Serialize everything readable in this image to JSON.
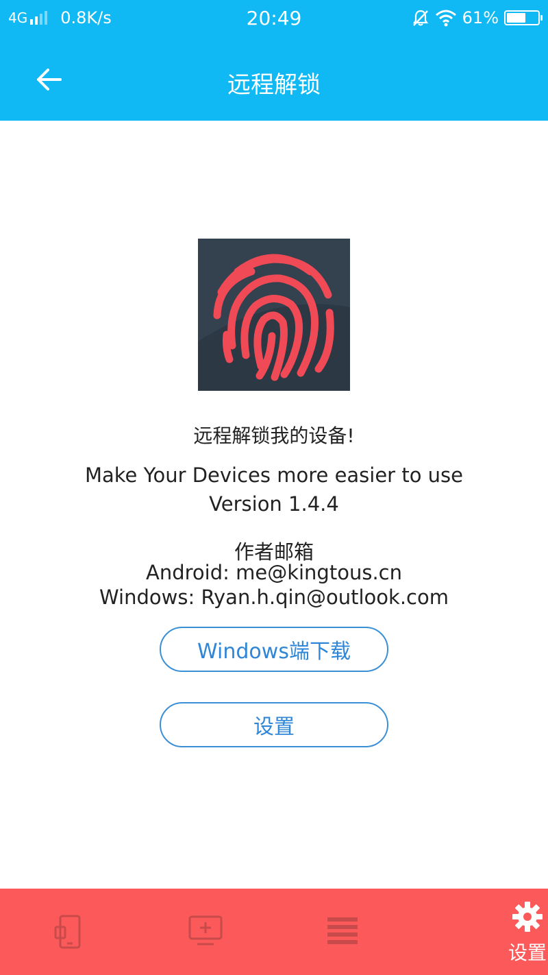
{
  "status_bar": {
    "network": "4G",
    "speed": "0.8K/s",
    "time": "20:49",
    "battery": "61%",
    "battery_level": 0.61
  },
  "app_bar": {
    "title": "远程解锁",
    "back_icon": "arrow-left-icon"
  },
  "about": {
    "logo_icon": "fingerprint-icon",
    "tagline": "远程解锁我的设备!",
    "slogan": "Make Your Devices more easier to use",
    "version": "Version 1.4.4",
    "email_heading": "作者邮箱",
    "email_android": "Android: me@kingtous.cn",
    "email_windows": "Windows: Ryan.h.qin@outlook.com"
  },
  "buttons": {
    "download": "Windows端下载",
    "settings": "设置"
  },
  "bottom_nav": {
    "items": [
      {
        "icon": "phone-icon",
        "label": ""
      },
      {
        "icon": "monitor-add-icon",
        "label": ""
      },
      {
        "icon": "list-icon",
        "label": ""
      },
      {
        "icon": "gear-icon",
        "label": "设置"
      }
    ]
  },
  "colors": {
    "primary": "#10b9f3",
    "nav_bg": "#fc5a5a",
    "button_border": "#3a8fd6",
    "logo_bg": "#34414e",
    "logo_fg": "#f04a57"
  }
}
